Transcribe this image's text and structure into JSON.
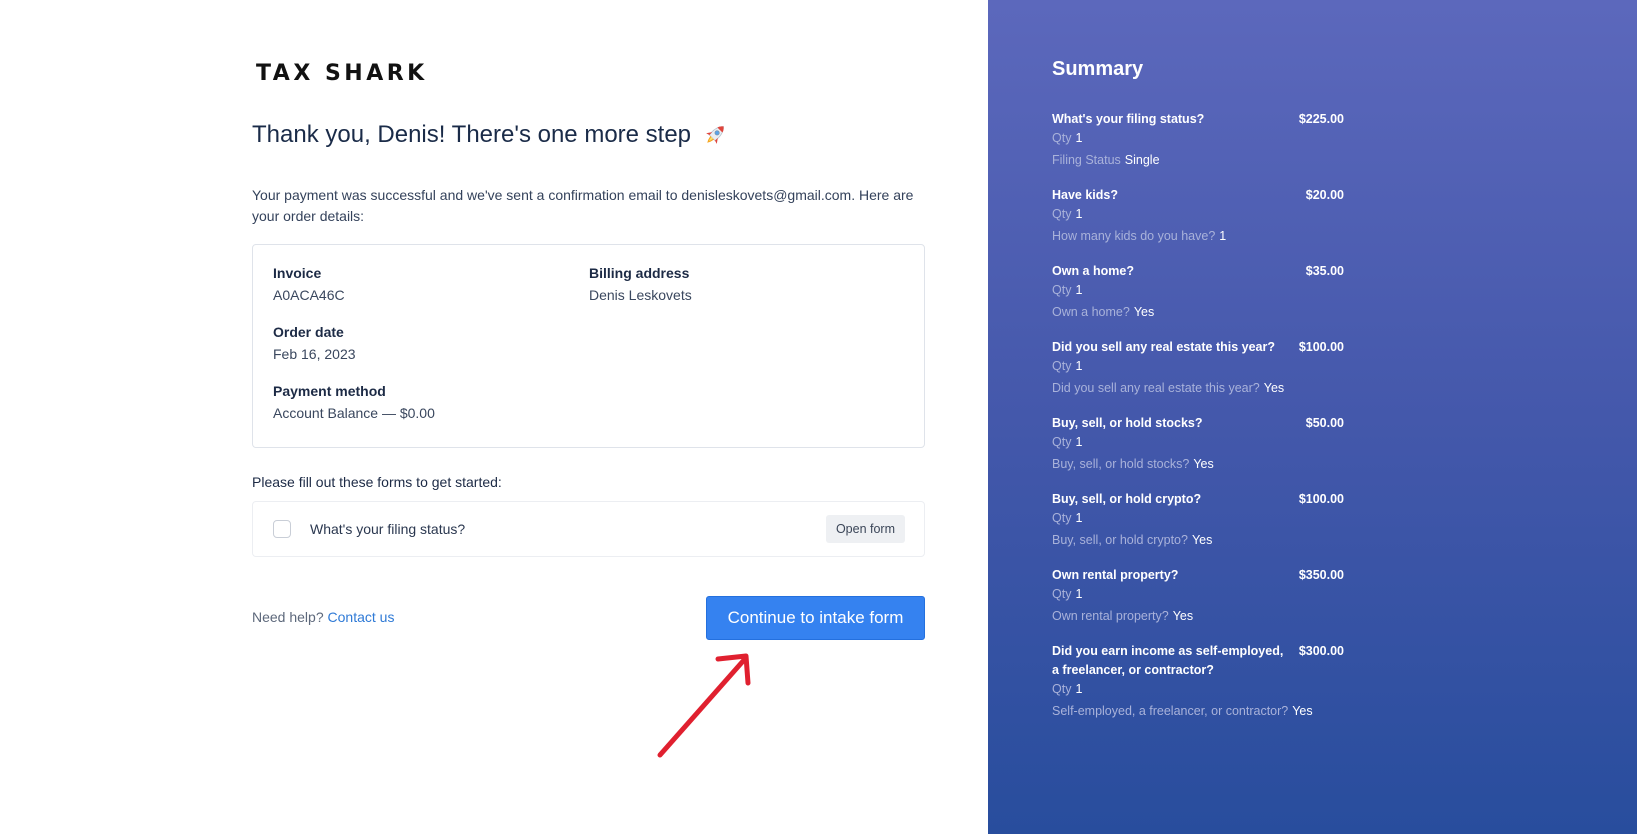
{
  "brand": {
    "name": "TAX SHARK"
  },
  "main": {
    "heading": "Thank you, Denis! There's one more step",
    "intro": "Your payment was successful and we've sent a confirmation email to denisleskovets@gmail.com. Here are your order details:",
    "invoice": {
      "label": "Invoice",
      "value": "A0ACA46C"
    },
    "billing": {
      "label": "Billing address",
      "value": "Denis Leskovets"
    },
    "order_date": {
      "label": "Order date",
      "value": "Feb 16, 2023"
    },
    "payment": {
      "label": "Payment method",
      "value": "Account Balance — $0.00"
    },
    "forms_label": "Please fill out these forms to get started:",
    "form_item": {
      "name": "What's your filing status?",
      "button": "Open form",
      "checked": false
    },
    "help_text": "Need help?",
    "help_link": "Contact us",
    "cta": "Continue to intake form"
  },
  "summary": {
    "title": "Summary",
    "qty_label": "Qty",
    "items": [
      {
        "question": "What's your filing status?",
        "price": "$225.00",
        "qty": "1",
        "detail_label": "Filing Status",
        "detail_value": "Single"
      },
      {
        "question": "Have kids?",
        "price": "$20.00",
        "qty": "1",
        "detail_label": "How many kids do you have?",
        "detail_value": "1"
      },
      {
        "question": "Own a home?",
        "price": "$35.00",
        "qty": "1",
        "detail_label": "Own a home?",
        "detail_value": "Yes"
      },
      {
        "question": "Did you sell any real estate this year?",
        "price": "$100.00",
        "qty": "1",
        "detail_label": "Did you sell any real estate this year?",
        "detail_value": "Yes"
      },
      {
        "question": "Buy, sell, or hold stocks?",
        "price": "$50.00",
        "qty": "1",
        "detail_label": "Buy, sell, or hold stocks?",
        "detail_value": "Yes"
      },
      {
        "question": "Buy, sell, or hold crypto?",
        "price": "$100.00",
        "qty": "1",
        "detail_label": "Buy, sell, or hold crypto?",
        "detail_value": "Yes"
      },
      {
        "question": "Own rental property?",
        "price": "$350.00",
        "qty": "1",
        "detail_label": "Own rental property?",
        "detail_value": "Yes"
      },
      {
        "question": "Did you earn income as self-employed, a freelancer, or contractor?",
        "price": "$300.00",
        "qty": "1",
        "detail_label": "Self-employed, a freelancer, or contractor?",
        "detail_value": "Yes"
      }
    ]
  },
  "colors": {
    "primary": "#3582f0",
    "link": "#2f7ad6",
    "panel_top": "#5c68bc",
    "panel_bottom": "#284d9d",
    "annotation_arrow": "#e0202f"
  },
  "icons": {
    "heading_emoji": "rocket-icon",
    "annotation": "arrow-annotation"
  }
}
